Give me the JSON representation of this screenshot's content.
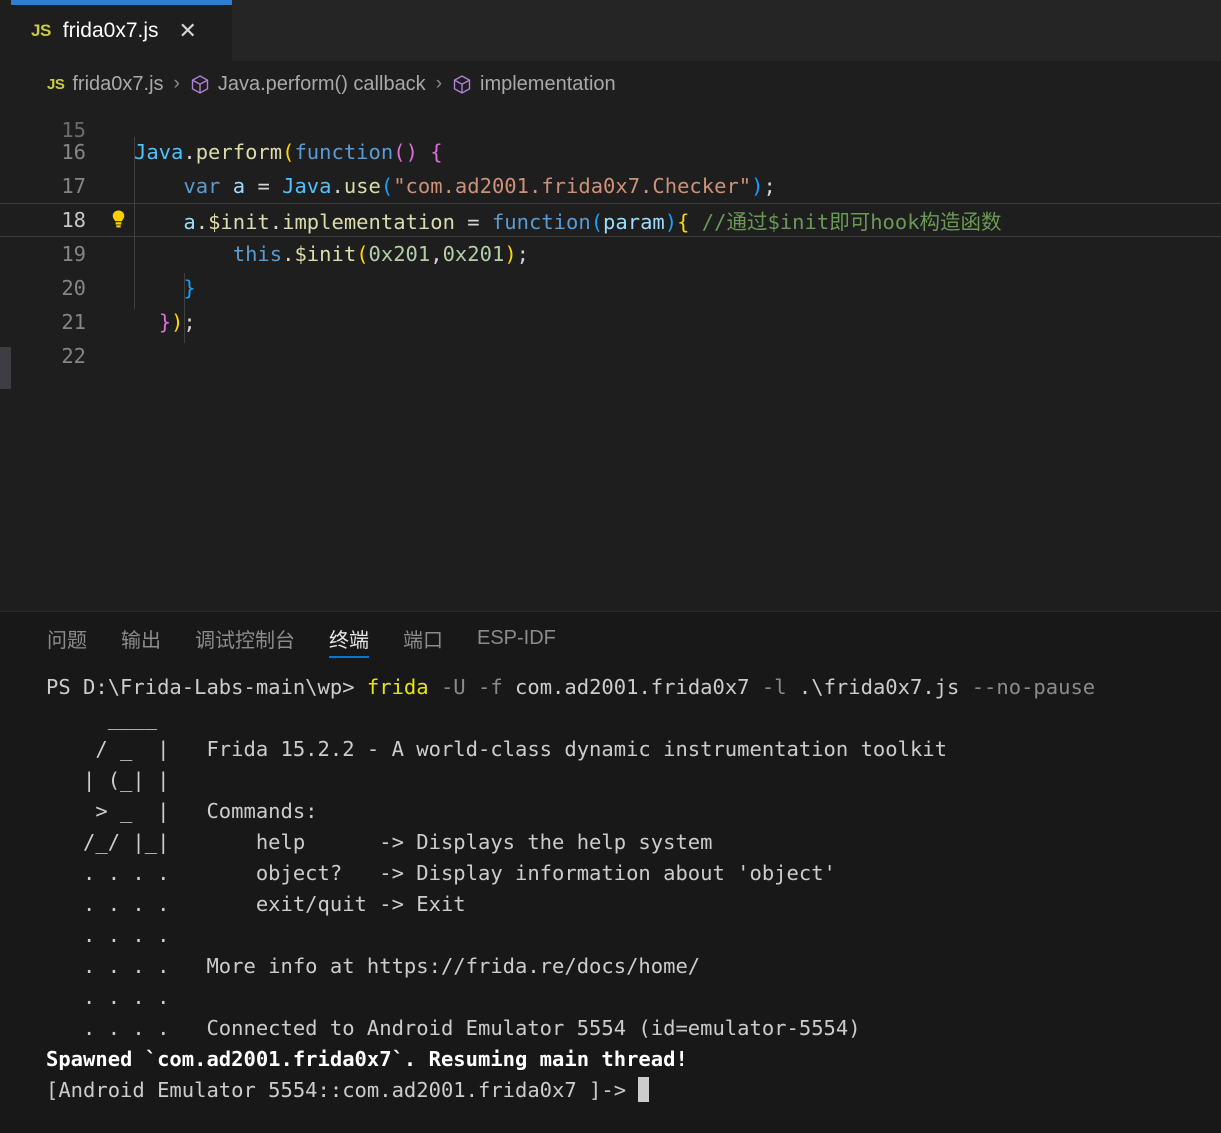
{
  "window": {
    "accent_color": "#2f7fd1",
    "editor_bg": "#1e1e1e",
    "panel_bg": "#181818"
  },
  "tabbar": {
    "tabs": [
      {
        "file_icon_label": "JS",
        "label": "frida0x7.js",
        "close_label": "✕",
        "active": true
      }
    ]
  },
  "breadcrumb": {
    "file_icon_label": "JS",
    "separator": "›",
    "items": [
      {
        "label": "frida0x7.js",
        "icon": "js-file-icon"
      },
      {
        "label": "Java.perform() callback",
        "icon": "symbol-cube-icon"
      },
      {
        "label": "implementation",
        "icon": "symbol-cube-icon"
      }
    ]
  },
  "editor": {
    "active_line_number": 18,
    "lines": [
      {
        "n": "15",
        "partial": true,
        "tokens": []
      },
      {
        "n": "16",
        "tokens": [
          {
            "t": "Java",
            "c": "t-blue"
          },
          {
            "t": ".",
            "c": "t-plain"
          },
          {
            "t": "perform",
            "c": "t-fn"
          },
          {
            "t": "(",
            "c": "t-p1"
          },
          {
            "t": "function",
            "c": "t-kw"
          },
          {
            "t": "(",
            "c": "t-p2"
          },
          {
            "t": ")",
            "c": "t-p2"
          },
          {
            "t": " ",
            "c": "t-plain"
          },
          {
            "t": "{",
            "c": "t-p2"
          }
        ]
      },
      {
        "n": "17",
        "tokens": [
          {
            "t": "    ",
            "c": "t-plain"
          },
          {
            "t": "var",
            "c": "t-kw"
          },
          {
            "t": " ",
            "c": "t-plain"
          },
          {
            "t": "a",
            "c": "t-ident"
          },
          {
            "t": " ",
            "c": "t-plain"
          },
          {
            "t": "=",
            "c": "t-plain"
          },
          {
            "t": " ",
            "c": "t-plain"
          },
          {
            "t": "Java",
            "c": "t-blue"
          },
          {
            "t": ".",
            "c": "t-plain"
          },
          {
            "t": "use",
            "c": "t-fn"
          },
          {
            "t": "(",
            "c": "t-p3"
          },
          {
            "t": "\"com.ad2001.frida0x7.Checker\"",
            "c": "t-str"
          },
          {
            "t": ")",
            "c": "t-p3"
          },
          {
            "t": ";",
            "c": "t-plain"
          }
        ]
      },
      {
        "n": "18",
        "active": true,
        "bulb": true,
        "tokens": [
          {
            "t": "    ",
            "c": "t-plain"
          },
          {
            "t": "a",
            "c": "t-ident"
          },
          {
            "t": ".",
            "c": "t-plain"
          },
          {
            "t": "$init",
            "c": "t-fn"
          },
          {
            "t": ".",
            "c": "t-plain"
          },
          {
            "t": "implementation",
            "c": "t-fn"
          },
          {
            "t": " ",
            "c": "t-plain"
          },
          {
            "t": "=",
            "c": "t-plain"
          },
          {
            "t": " ",
            "c": "t-plain"
          },
          {
            "t": "function",
            "c": "t-kw"
          },
          {
            "t": "(",
            "c": "t-p3"
          },
          {
            "t": "param",
            "c": "t-ident"
          },
          {
            "t": ")",
            "c": "t-p3"
          },
          {
            "t": "{",
            "c": "t-p1"
          },
          {
            "t": " ",
            "c": "t-plain"
          },
          {
            "t": "//通过$init即可hook构造函数",
            "c": "t-cmt"
          }
        ]
      },
      {
        "n": "19",
        "tokens": [
          {
            "t": "        ",
            "c": "t-plain"
          },
          {
            "t": "this",
            "c": "t-kw"
          },
          {
            "t": ".",
            "c": "t-plain"
          },
          {
            "t": "$init",
            "c": "t-fn"
          },
          {
            "t": "(",
            "c": "t-p1"
          },
          {
            "t": "0x201",
            "c": "t-num"
          },
          {
            "t": ",",
            "c": "t-plain"
          },
          {
            "t": "0x201",
            "c": "t-num"
          },
          {
            "t": ")",
            "c": "t-p1"
          },
          {
            "t": ";",
            "c": "t-plain"
          }
        ]
      },
      {
        "n": "20",
        "tokens": [
          {
            "t": "    ",
            "c": "t-plain"
          },
          {
            "t": "}",
            "c": "t-p3"
          }
        ]
      },
      {
        "n": "21",
        "tokens": [
          {
            "t": "  ",
            "c": "t-plain"
          },
          {
            "t": "}",
            "c": "t-p2"
          },
          {
            "t": ")",
            "c": "t-p1"
          },
          {
            "t": ";",
            "c": "t-plain"
          }
        ]
      },
      {
        "n": "22",
        "tokens": []
      }
    ]
  },
  "panel": {
    "tabs": [
      {
        "label": "问题",
        "active": false
      },
      {
        "label": "输出",
        "active": false
      },
      {
        "label": "调试控制台",
        "active": false
      },
      {
        "label": "终端",
        "active": true
      },
      {
        "label": "端口",
        "active": false
      },
      {
        "label": "ESP-IDF",
        "active": false
      }
    ]
  },
  "terminal": {
    "lines": [
      {
        "segs": [
          {
            "t": "PS D:\\Frida-Labs-main\\wp> ",
            "c": "c-dim"
          },
          {
            "t": "frida",
            "c": "c-yellow"
          },
          {
            "t": " ",
            "c": "c-dim"
          },
          {
            "t": "-U -f",
            "c": "c-gray"
          },
          {
            "t": " com.ad2001.frida0x7 ",
            "c": "c-dim"
          },
          {
            "t": "-l",
            "c": "c-gray"
          },
          {
            "t": " .\\frida0x7.js ",
            "c": "c-dim"
          },
          {
            "t": "--no-pause",
            "c": "c-gray"
          }
        ]
      },
      {
        "segs": [
          {
            "t": "     ____",
            "c": "c-dim"
          }
        ]
      },
      {
        "segs": [
          {
            "t": "    / _  |   Frida 15.2.2 - A world-class dynamic instrumentation toolkit",
            "c": "c-dim"
          }
        ]
      },
      {
        "segs": [
          {
            "t": "   | (_| |",
            "c": "c-dim"
          }
        ]
      },
      {
        "segs": [
          {
            "t": "    > _  |   Commands:",
            "c": "c-dim"
          }
        ]
      },
      {
        "segs": [
          {
            "t": "   /_/ |_|       help      -> Displays the help system",
            "c": "c-dim"
          }
        ]
      },
      {
        "segs": [
          {
            "t": "   . . . .       object?   -> Display information about 'object'",
            "c": "c-dim"
          }
        ]
      },
      {
        "segs": [
          {
            "t": "   . . . .       exit/quit -> Exit",
            "c": "c-dim"
          }
        ]
      },
      {
        "segs": [
          {
            "t": "   . . . .",
            "c": "c-dim"
          }
        ]
      },
      {
        "segs": [
          {
            "t": "   . . . .   More info at https://frida.re/docs/home/",
            "c": "c-dim"
          }
        ]
      },
      {
        "segs": [
          {
            "t": "   . . . .",
            "c": "c-dim"
          }
        ]
      },
      {
        "segs": [
          {
            "t": "   . . . .   Connected to Android Emulator 5554 (id=emulator-5554)",
            "c": "c-dim"
          }
        ]
      },
      {
        "segs": [
          {
            "t": "Spawned `com.ad2001.frida0x7`. Resuming main thread!",
            "c": "c-bold"
          }
        ]
      },
      {
        "segs": [
          {
            "t": "[Android Emulator 5554::com.ad2001.frida0x7 ]-> ",
            "c": "c-dim"
          }
        ],
        "cursor": true
      }
    ]
  }
}
